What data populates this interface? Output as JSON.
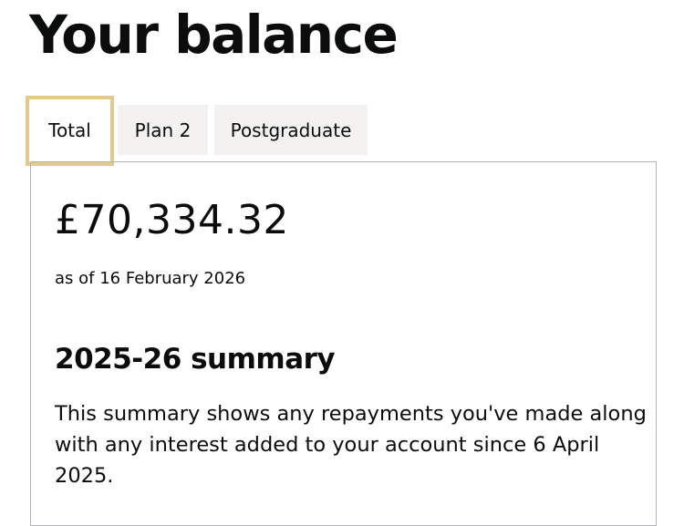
{
  "page": {
    "title": "Your balance"
  },
  "tabs": [
    {
      "label": "Total",
      "selected": true
    },
    {
      "label": "Plan 2",
      "selected": false
    },
    {
      "label": "Postgraduate",
      "selected": false
    }
  ],
  "panel": {
    "amount": "£70,334.32",
    "as_of": "as of 16 February 2026",
    "summary_heading": "2025-26 summary",
    "summary_text": "This summary shows any repayments you've made along with any interest added to your account since 6 April 2025."
  },
  "colors": {
    "text": "#0b0c0c",
    "tab_background": "#f3f2f1",
    "focus_outline": "#e3c98c",
    "panel_border": "#b1b4b6"
  }
}
